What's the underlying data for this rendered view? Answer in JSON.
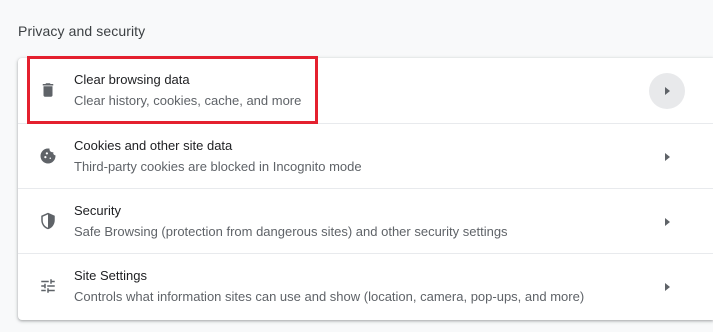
{
  "section": {
    "title": "Privacy and security"
  },
  "rows": [
    {
      "title": "Clear browsing data",
      "description": "Clear history, cookies, cache, and more",
      "icon": "trash-icon"
    },
    {
      "title": "Cookies and other site data",
      "description": "Third-party cookies are blocked in Incognito mode",
      "icon": "cookie-icon"
    },
    {
      "title": "Security",
      "description": "Safe Browsing (protection from dangerous sites) and other security settings",
      "icon": "shield-icon"
    },
    {
      "title": "Site Settings",
      "description": "Controls what information sites can use and show (location, camera, pop-ups, and more)",
      "icon": "tune-icon"
    }
  ],
  "colors": {
    "highlight": "#e4202f",
    "icon": "#5f6368",
    "hover": "#e8e9eb"
  }
}
